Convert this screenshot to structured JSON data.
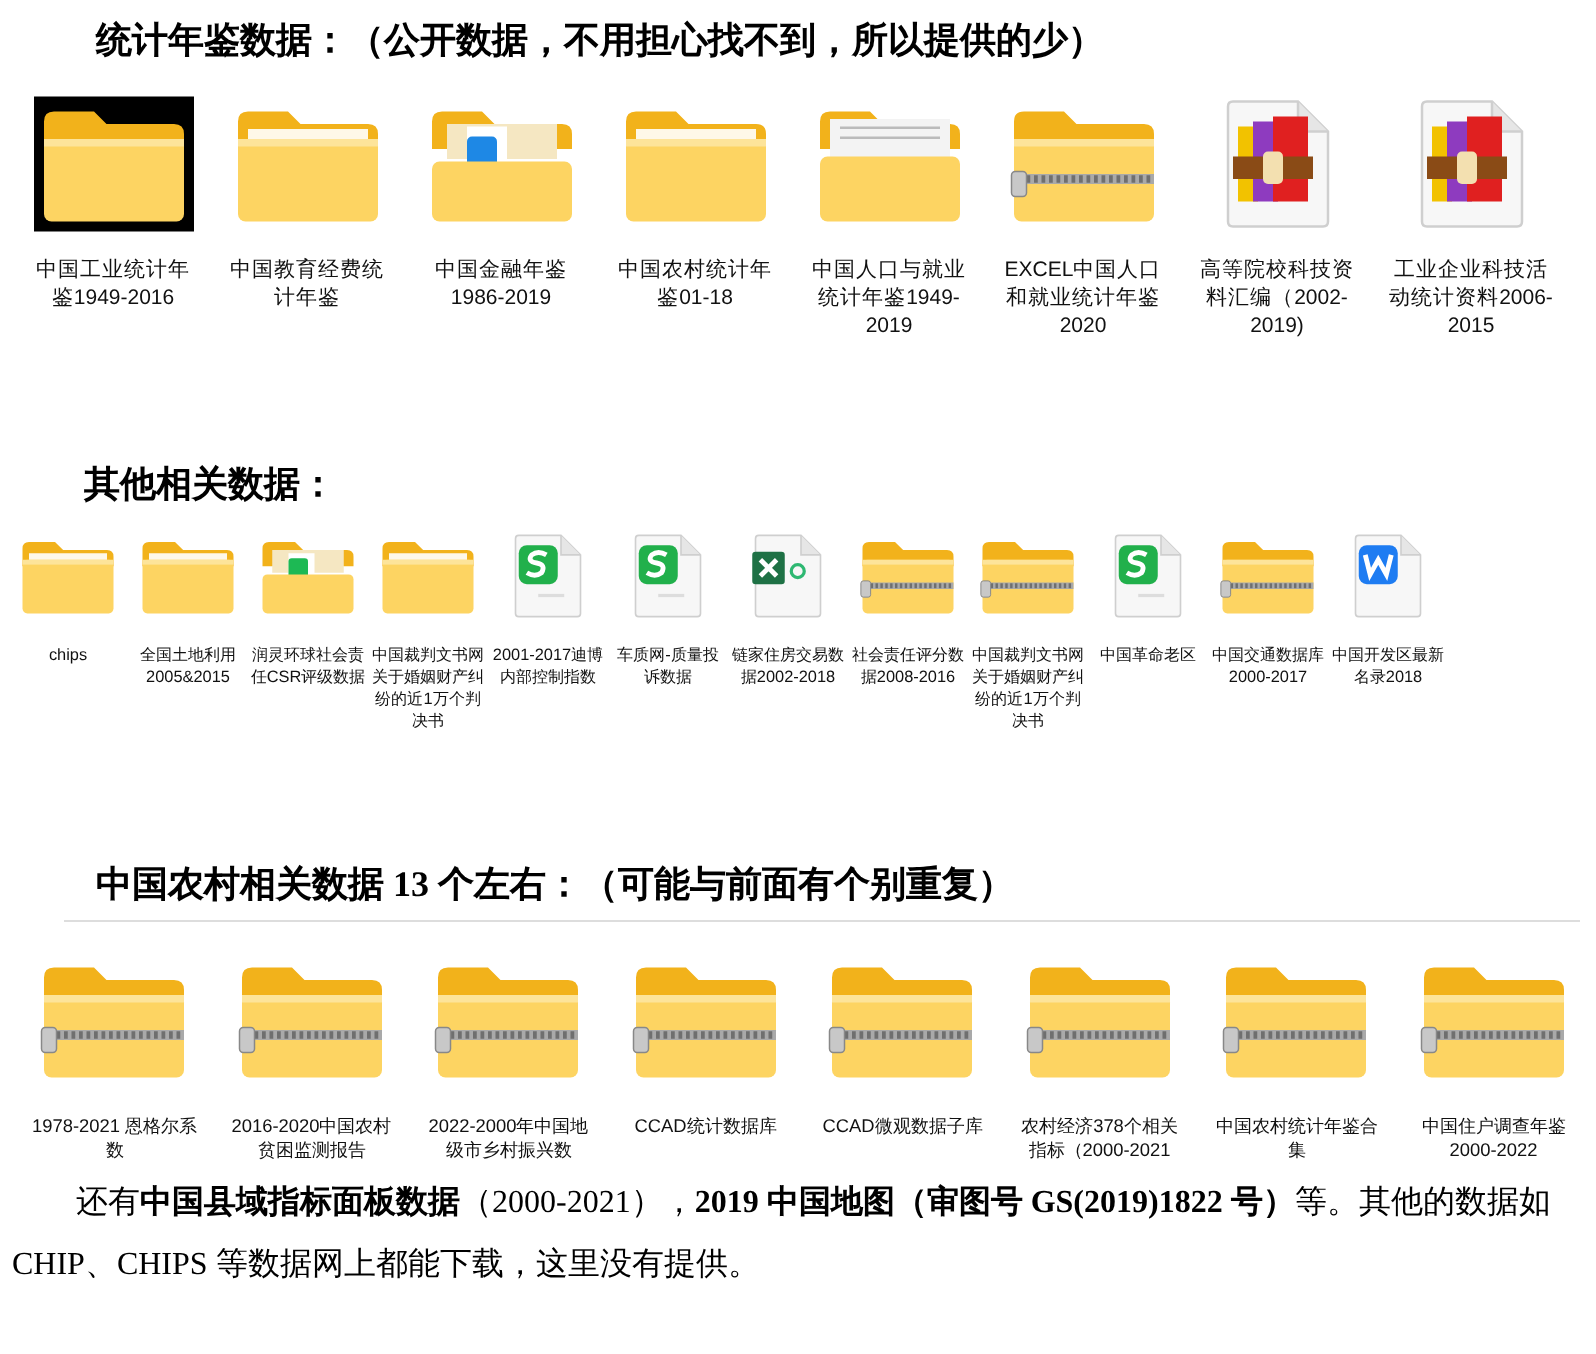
{
  "sections": [
    {
      "heading": "统计年鉴数据：（公开数据，不用担心找不到，所以提供的少）",
      "divider": false,
      "files": [
        {
          "kind": "darkfolder",
          "label": "中国工业统计年鉴1949-2016"
        },
        {
          "kind": "folder",
          "label": "中国教育经费统计年鉴"
        },
        {
          "kind": "previewfolder",
          "label": "中国金融年鉴1986-2019"
        },
        {
          "kind": "folder",
          "label": "中国农村统计年鉴01-18"
        },
        {
          "kind": "paperfolder",
          "label": "中国人口与就业统计年鉴1949-2019"
        },
        {
          "kind": "zipfolder",
          "label": "EXCEL中国人口和就业统计年鉴2020"
        },
        {
          "kind": "rar",
          "label": "高等院校科技资料汇编（2002-2019)"
        },
        {
          "kind": "rar",
          "label": "工业企业科技活动统计资料2006-2015"
        }
      ]
    },
    {
      "heading": "其他相关数据：",
      "divider": false,
      "files": [
        {
          "kind": "folder",
          "label": "chips"
        },
        {
          "kind": "folder",
          "label": "全国土地利用2005&2015"
        },
        {
          "kind": "sheetfolder",
          "label": "润灵环球社会责任CSR评级数据"
        },
        {
          "kind": "folder",
          "label": "中国裁判文书网关于婚姻财产纠纷的近1万个判决书"
        },
        {
          "kind": "sheet",
          "label": "2001-2017迪博内部控制指数"
        },
        {
          "kind": "sheet",
          "label": "车质网-质量投诉数据"
        },
        {
          "kind": "excel",
          "label": "链家住房交易数据2002-2018"
        },
        {
          "kind": "zipfolder",
          "label": "社会责任评分数据2008-2016"
        },
        {
          "kind": "zipfolder",
          "label": "中国裁判文书网关于婚姻财产纠纷的近1万个判决书"
        },
        {
          "kind": "sheet",
          "label": "中国革命老区"
        },
        {
          "kind": "zipfolder",
          "label": "中国交通数据库2000-2017"
        },
        {
          "kind": "word",
          "label": "中国开发区最新名录2018"
        }
      ]
    },
    {
      "heading": "中国农村相关数据 13 个左右：（可能与前面有个别重复）",
      "divider": true,
      "files": [
        {
          "kind": "zipfolder",
          "label": "1978-2021 恩格尔系数"
        },
        {
          "kind": "zipfolder",
          "label": "2016-2020中国农村贫困监测报告"
        },
        {
          "kind": "zipfolder",
          "label": "2022-2000年中国地级市乡村振兴数"
        },
        {
          "kind": "zipfolder",
          "label": "CCAD统计数据库"
        },
        {
          "kind": "zipfolder",
          "label": "CCAD微观数据子库"
        },
        {
          "kind": "zipfolder",
          "label": "农村经济378个相关指标（2000-2021"
        },
        {
          "kind": "zipfolder",
          "label": "中国农村统计年鉴合集"
        },
        {
          "kind": "zipfolder",
          "label": "中国住户调查年鉴2000-2022"
        }
      ]
    }
  ],
  "note": "还有**中国县域指标面板数据**（2000-2021），**2019 中国地图（审图号 GS(2019)1822 号）**等。其他的数据如 CHIP、CHIPS 等数据网上都能下载，这里没有提供。"
}
